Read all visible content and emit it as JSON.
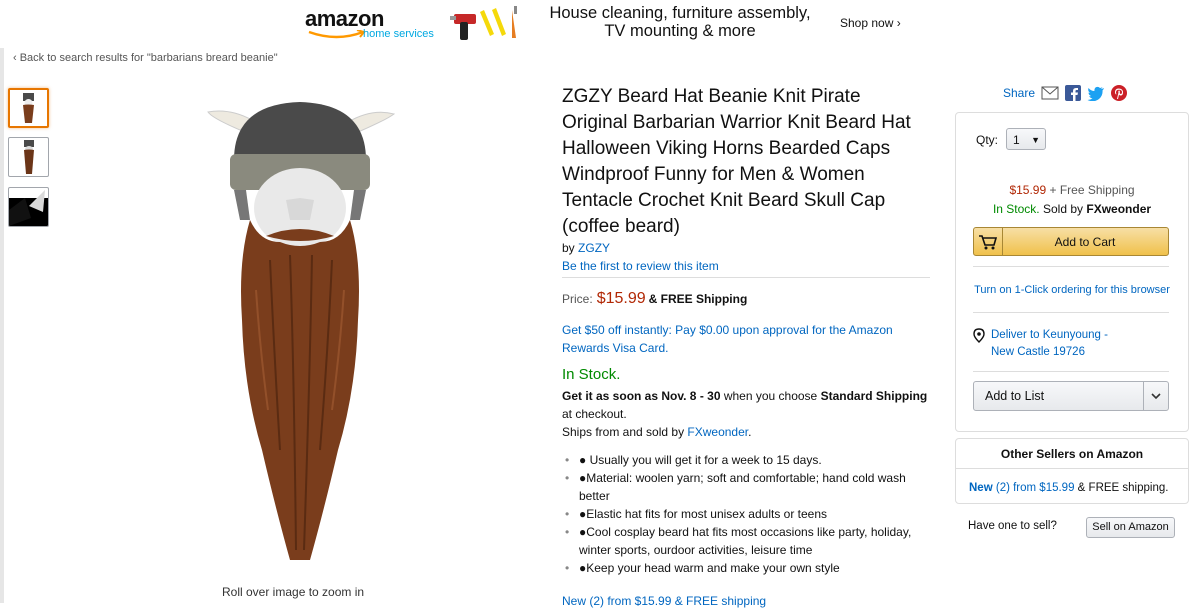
{
  "banner": {
    "logo_text": "amazon",
    "logo_sub": "home services",
    "headline_line1": "House cleaning, furniture assembly,",
    "headline_line2": "TV mounting & more",
    "shop_now": "Shop now ›"
  },
  "breadcrumb": "‹ Back to search results for \"barbarians breard beanie\"",
  "gallery": {
    "thumbnails": [
      "thumbnail-1",
      "thumbnail-2",
      "thumbnail-3"
    ],
    "selected_index": 0,
    "zoom_hint": "Roll over image to zoom in"
  },
  "product": {
    "title": "ZGZY Beard Hat Beanie Knit Pirate Original Barbarian Warrior Knit Beard Hat Halloween Viking Horns Bearded Caps Windproof Funny for Men & Women Tentacle Crochet Knit Beard Skull Cap (coffee beard)",
    "by_label": "by",
    "brand": "ZGZY",
    "review_link": "Be the first to review this item",
    "price_label": "Price:",
    "price": "$15.99",
    "shipping": "& FREE Shipping",
    "promo": "Get $50 off instantly: Pay $0.00 upon approval for the Amazon Rewards Visa Card.",
    "stock": "In Stock.",
    "delivery_prefix": "Get it as soon as Nov. 8 - 30",
    "delivery_middle": " when you choose ",
    "delivery_option": "Standard Shipping",
    "delivery_suffix": " at checkout.",
    "ships_from": "Ships from and sold by ",
    "seller": "FXweonder",
    "bullets": [
      "● Usually you will get it for a week to 15 days.",
      "●Material: woolen yarn; soft and comfortable; hand cold wash better",
      "●Elastic hat fits for most unisex adults or teens",
      "●Cool cosplay beard hat fits most occasions like party, holiday, winter sports, ourdoor activities, leisure time",
      "●Keep your head warm and make your own style"
    ],
    "cutoff_text": "New (2) from $15.99 & FREE shipping"
  },
  "share": {
    "label": "Share"
  },
  "buybox": {
    "qty_label": "Qty:",
    "qty_value": "1",
    "price": "$15.99",
    "shipping": "+ Free Shipping",
    "stock": "In Stock.",
    "sold_by_label": "Sold by",
    "sold_by": "FXweonder",
    "add_to_cart": "Add to Cart",
    "one_click": "Turn on 1-Click ordering for this browser",
    "deliver_line1": "Deliver to Keunyoung -",
    "deliver_line2": "New Castle 19726",
    "add_to_list": "Add to List"
  },
  "other_sellers": {
    "heading": "Other Sellers on Amazon",
    "new_label": "New",
    "offer_link": "(2) from $15.99",
    "offer_suffix": " & FREE shipping."
  },
  "sell": {
    "prompt": "Have one to sell?",
    "button": "Sell on Amazon"
  },
  "colors": {
    "link": "#0066c0",
    "price": "#b12704",
    "in_stock": "#008a00",
    "cart_button": "#f0c14b",
    "beard": "#7a3d1c",
    "hat": "#4a4a4a"
  }
}
